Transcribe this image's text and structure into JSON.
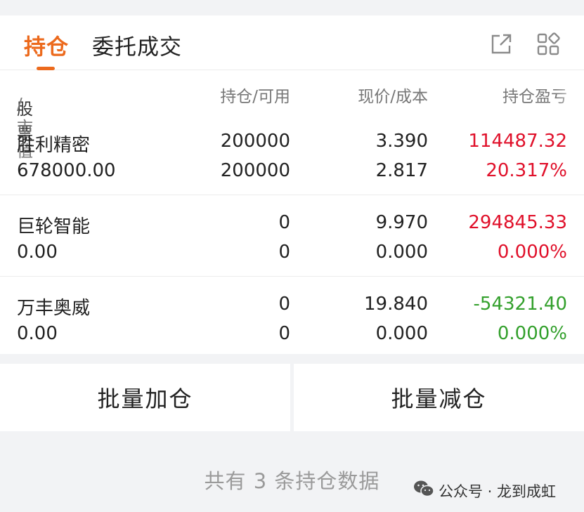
{
  "tabs": [
    {
      "label": "持仓",
      "active": true
    },
    {
      "label": "委托成交",
      "active": false
    }
  ],
  "icons": {
    "export": "external-link-icon",
    "grid": "apps-grid-icon"
  },
  "colors": {
    "accent": "#ec6a1d",
    "up": "#e0102a",
    "down": "#33a02c"
  },
  "header": {
    "stock": "股票",
    "market_value": "/市值",
    "position": "持仓/可用",
    "price": "现价/成本",
    "pnl": "持仓盈亏"
  },
  "positions": [
    {
      "name": "胜利精密",
      "market_value": "678000.00",
      "holding": "200000",
      "available": "200000",
      "price": "3.390",
      "cost": "2.817",
      "pnl": "114487.32",
      "pnl_pct": "20.317%",
      "trend": "up"
    },
    {
      "name": "巨轮智能",
      "market_value": "0.00",
      "holding": "0",
      "available": "0",
      "price": "9.970",
      "cost": "0.000",
      "pnl": "294845.33",
      "pnl_pct": "0.000%",
      "trend": "up"
    },
    {
      "name": "万丰奥威",
      "market_value": "0.00",
      "holding": "0",
      "available": "0",
      "price": "19.840",
      "cost": "0.000",
      "pnl": "-54321.40",
      "pnl_pct": "0.000%",
      "trend": "down"
    }
  ],
  "actions": {
    "batch_add": "批量加仓",
    "batch_reduce": "批量减仓"
  },
  "summary": "共有 3 条持仓数据",
  "watermark": "公众号 · 龙到成虹"
}
